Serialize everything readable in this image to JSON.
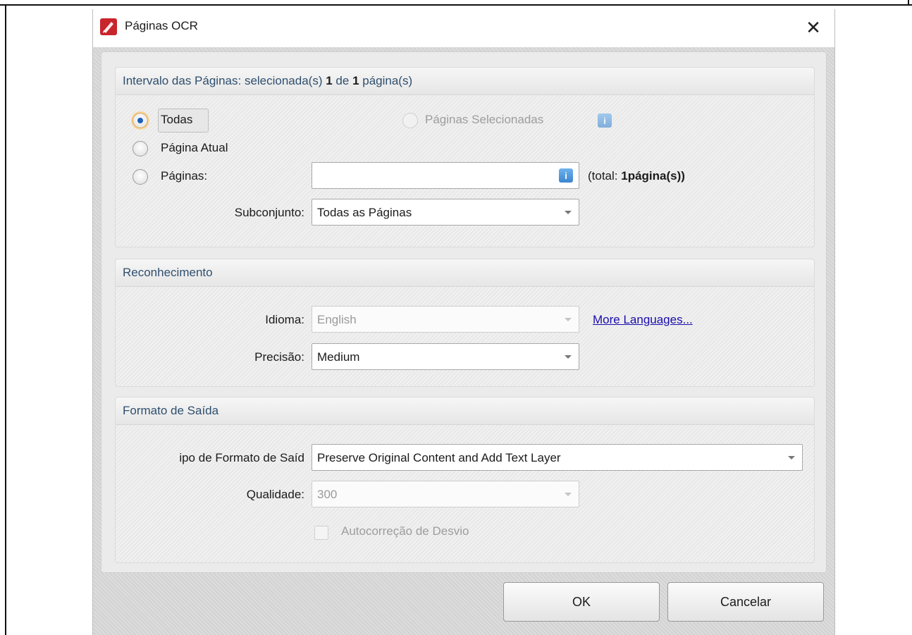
{
  "dialog": {
    "title": "Páginas OCR",
    "close_glyph": "✕"
  },
  "page_range": {
    "header_prefix": "Intervalo das Páginas: selecionada(s) ",
    "selected_count": "1",
    "header_mid": " de ",
    "total_count": "1",
    "header_suffix": " página(s)",
    "radio_all": "Todas",
    "radio_selected": "Páginas Selecionadas",
    "radio_current": "Página Atual",
    "radio_pages": "Páginas:",
    "pages_value": "",
    "total_prefix": "(total: ",
    "total_value": "1página(s))",
    "subset_label": "Subconjunto:",
    "subset_value": "Todas as Páginas"
  },
  "recognition": {
    "header": "Reconhecimento",
    "language_label": "Idioma:",
    "language_value": "English",
    "more_languages": "More Languages...",
    "accuracy_label": "Precisão:",
    "accuracy_value": "Medium"
  },
  "output": {
    "header": "Formato de Saída",
    "format_label": "ipo de Formato de Saíd",
    "format_value": "Preserve Original Content and Add Text Layer",
    "quality_label": "Qualidade:",
    "quality_value": "300",
    "deskew_label": "Autocorreção de Desvio"
  },
  "buttons": {
    "ok": "OK",
    "cancel": "Cancelar"
  },
  "icons": {
    "app": "pdf-xchange-icon",
    "info": "info-icon",
    "info_glyph": "i"
  }
}
